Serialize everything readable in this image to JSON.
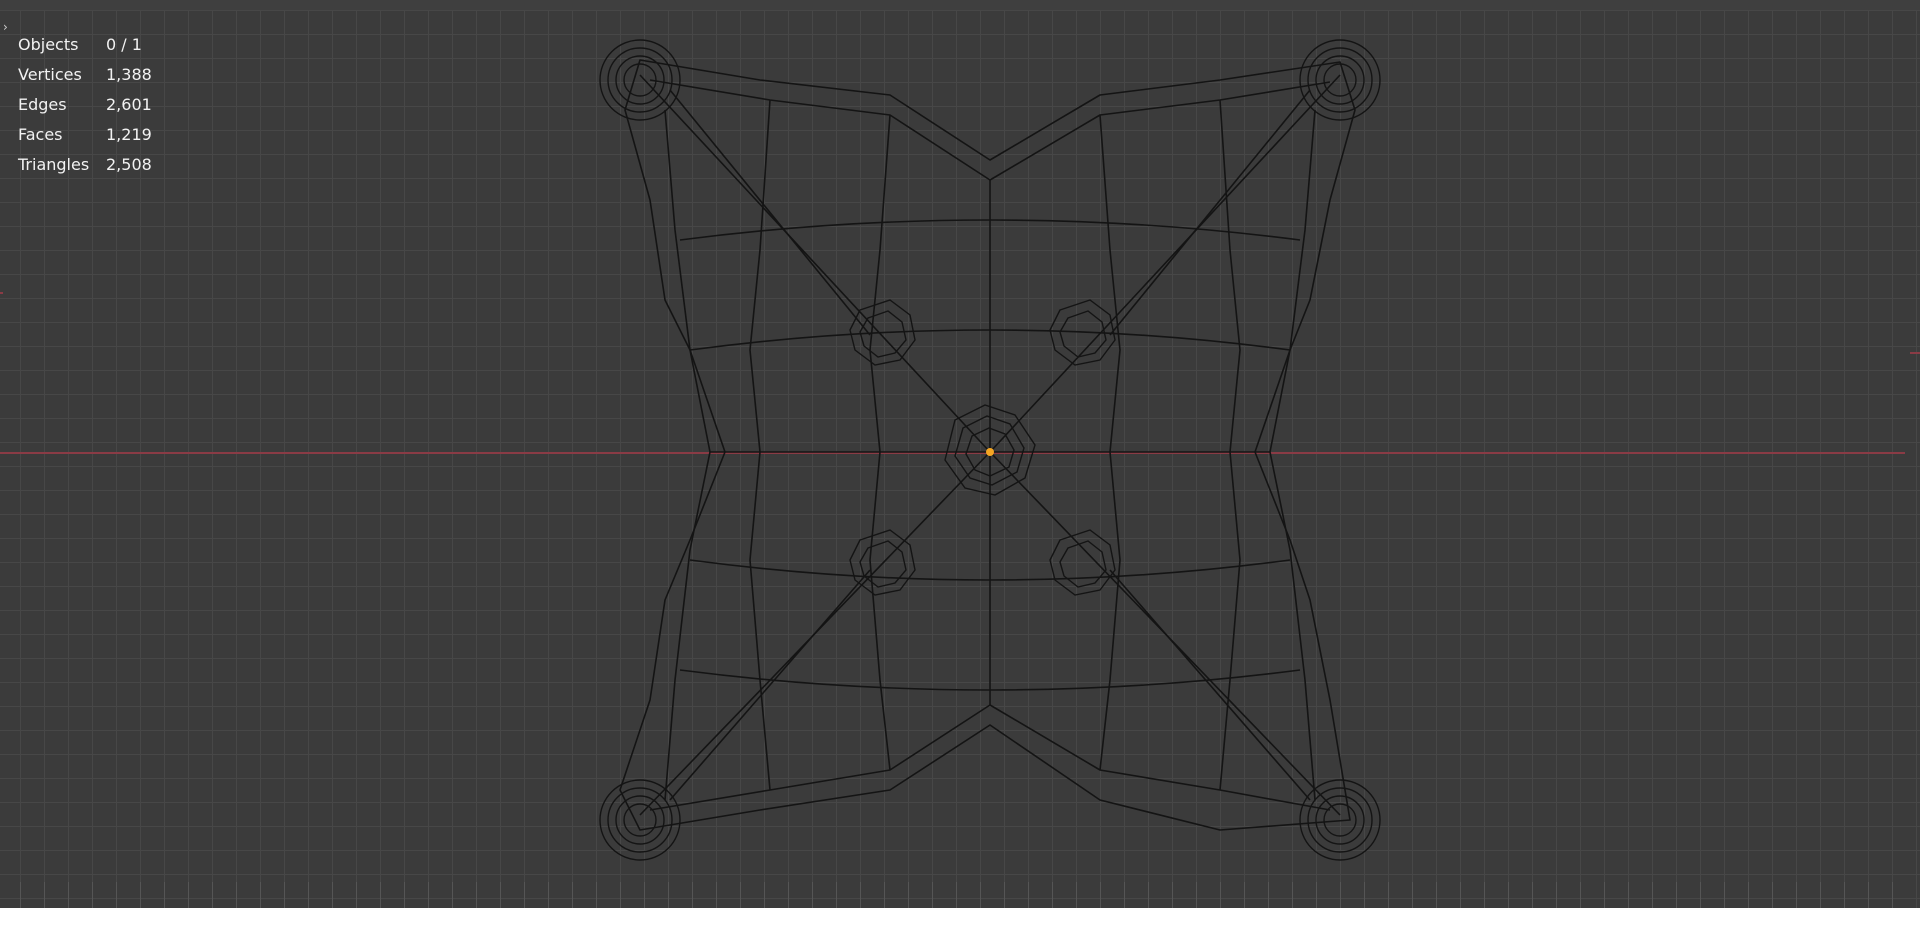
{
  "viewport": {
    "background_color": "#3b3b3b",
    "grid_color": "#474747",
    "axis_color": "#8a3b45",
    "origin_color": "#f5a623",
    "wire_color": "#111111"
  },
  "toggle_icon": "chevron-right-icon",
  "toggle_glyph": "›",
  "stats": [
    {
      "label": "Objects",
      "value": "0 / 1"
    },
    {
      "label": "Vertices",
      "value": "1,388"
    },
    {
      "label": "Edges",
      "value": "2,601"
    },
    {
      "label": "Faces",
      "value": "1,219"
    },
    {
      "label": "Triangles",
      "value": "2,508"
    }
  ]
}
